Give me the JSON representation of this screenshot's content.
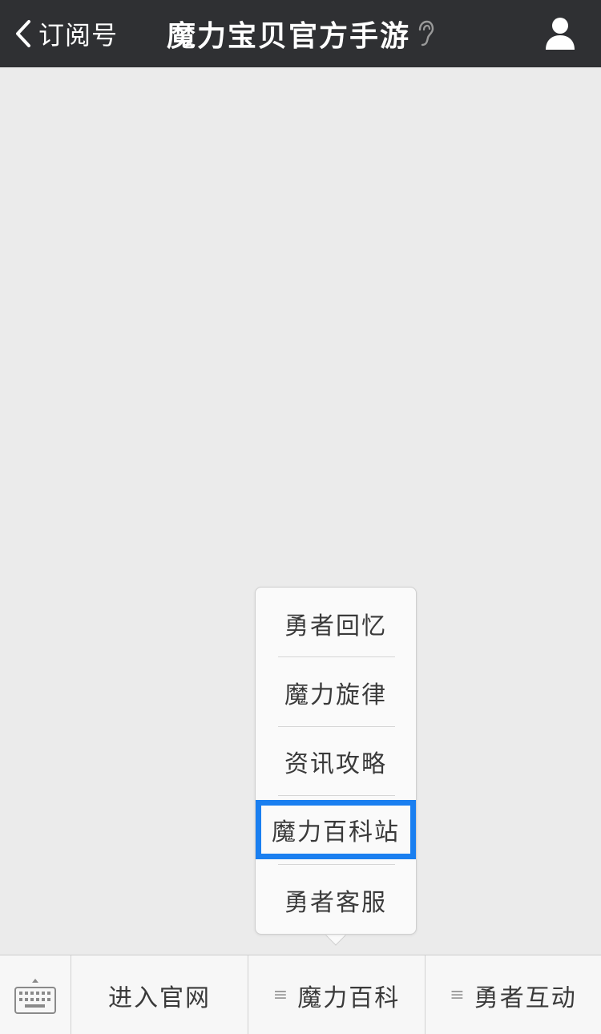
{
  "header": {
    "back_label": "订阅号",
    "title": "魔力宝贝官方手游"
  },
  "popup_menu": {
    "items": [
      {
        "label": "勇者回忆"
      },
      {
        "label": "魔力旋律"
      },
      {
        "label": "资讯攻略"
      },
      {
        "label": "魔力百科站",
        "highlighted": true
      },
      {
        "label": "勇者客服"
      }
    ],
    "highlight_color": "#1a7ff0"
  },
  "bottom_bar": {
    "tabs": [
      {
        "label": "进入官网"
      },
      {
        "label": "魔力百科"
      },
      {
        "label": "勇者互动"
      }
    ]
  },
  "icons": [
    "chevron-left-icon",
    "ear-icon",
    "profile-icon",
    "keyboard-icon",
    "menu-lines-icon"
  ],
  "colors": {
    "header_bg": "#2f3033",
    "page_bg": "#ebebeb",
    "accent": "#1a7ff0"
  }
}
